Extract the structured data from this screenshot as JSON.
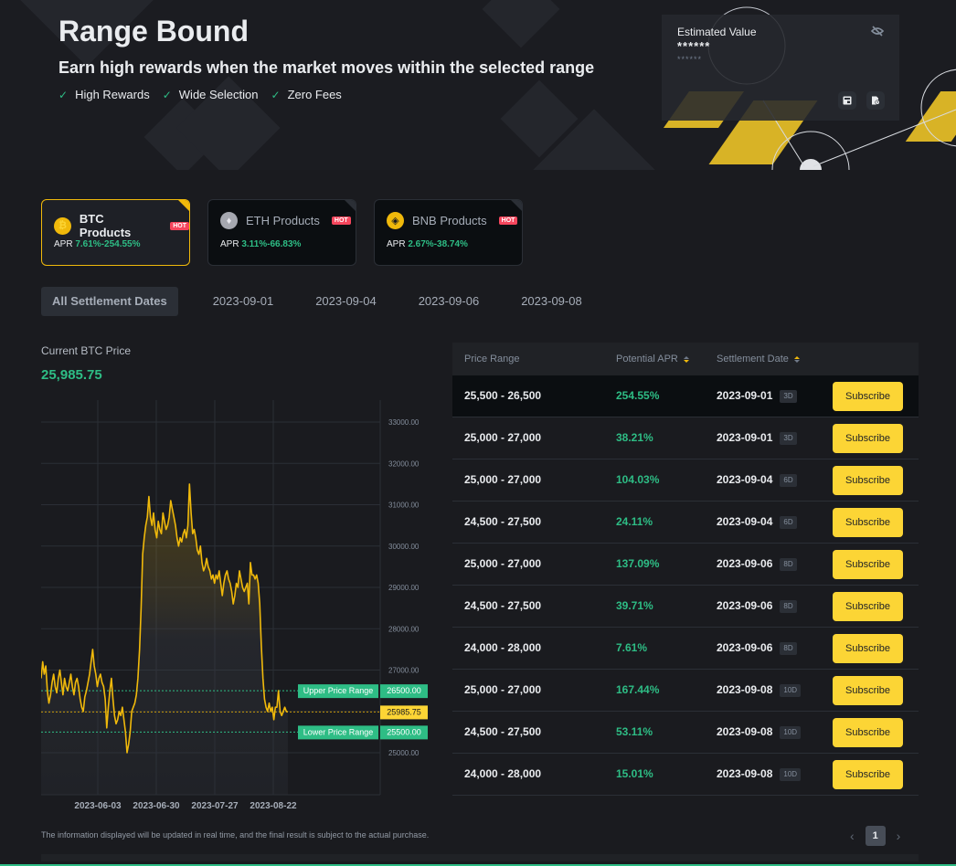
{
  "hero": {
    "title": "Range Bound",
    "subtitle": "Earn high rewards when the market moves within the selected range",
    "features": [
      "High Rewards",
      "Wide Selection",
      "Zero Fees"
    ]
  },
  "estimated": {
    "label": "Estimated Value",
    "value": "******",
    "sub_value": "******"
  },
  "products": [
    {
      "name": "BTC Products",
      "coin": "btc",
      "glyph": "₿",
      "badge": "HOT",
      "apr_label": "APR",
      "apr": "7.61%-254.55%",
      "active": true
    },
    {
      "name": "ETH Products",
      "coin": "eth",
      "glyph": "♦",
      "badge": "HOT",
      "apr_label": "APR",
      "apr": "3.11%-66.83%",
      "active": false
    },
    {
      "name": "BNB Products",
      "coin": "bnb",
      "glyph": "◈",
      "badge": "HOT",
      "apr_label": "APR",
      "apr": "2.67%-38.74%",
      "active": false
    }
  ],
  "date_tabs": [
    "All Settlement Dates",
    "2023-09-01",
    "2023-09-04",
    "2023-09-06",
    "2023-09-08"
  ],
  "active_date_tab": 0,
  "current_price": {
    "label": "Current BTC Price",
    "value": "25,985.75"
  },
  "chart_data": {
    "type": "line",
    "title": "BTC Price",
    "xlabel": "",
    "ylabel": "",
    "x_ticks": [
      "2023-06-03",
      "2023-06-30",
      "2023-07-27",
      "2023-08-22"
    ],
    "y_ticks": [
      "33000.00",
      "32000.00",
      "31000.00",
      "30000.00",
      "29000.00",
      "28000.00",
      "27000.00",
      "25000.00"
    ],
    "ylim": [
      24200,
      33500
    ],
    "grid": true,
    "series": [
      {
        "name": "BTC",
        "values": [
          26800,
          27200,
          26900,
          27100,
          26500,
          26200,
          26400,
          26700,
          26900,
          26600,
          26450,
          26800,
          27000,
          26700,
          26400,
          26800,
          26600,
          26500,
          26700,
          26900,
          26600,
          26400,
          26700,
          26800,
          26600,
          26300,
          26100,
          26000,
          26350,
          26500,
          26700,
          26900,
          27200,
          27500,
          27100,
          26900,
          26600,
          26800,
          26900,
          26700,
          26600,
          26300,
          25600,
          26100,
          26500,
          26800,
          26300,
          25900,
          25700,
          25800,
          26000,
          25900,
          26100,
          25800,
          25500,
          25000,
          25200,
          25500,
          26000,
          26100,
          26200,
          26400,
          26800,
          27500,
          28500,
          29800,
          30200,
          30500,
          30700,
          31200,
          30700,
          30500,
          30800,
          30400,
          30200,
          30600,
          30400,
          30300,
          30800,
          30600,
          30400,
          30500,
          30700,
          31100,
          30900,
          30700,
          30500,
          30200,
          30000,
          30200,
          30100,
          30300,
          30400,
          30200,
          30500,
          31500,
          30800,
          30300,
          30400,
          30200,
          29900,
          29800,
          30000,
          29600,
          29400,
          29500,
          29700,
          29500,
          29400,
          29200,
          29300,
          29100,
          29300,
          29200,
          29400,
          29100,
          28800,
          29100,
          29300,
          29400,
          29200,
          29100,
          28900,
          28600,
          28800,
          29100,
          29000,
          29400,
          29200,
          29000,
          28900,
          29000,
          29100,
          28600,
          29600,
          29300,
          29300,
          29200,
          29300,
          29100,
          28600,
          27600,
          26800,
          26300,
          26100,
          26000,
          26200,
          26000,
          26100,
          25800,
          26100,
          26100,
          26500,
          26000,
          25900,
          26000,
          26100,
          26000,
          25985.75
        ]
      }
    ],
    "current_price": 25985.75,
    "upper_range": {
      "label": "Upper Price Range",
      "value": 26500.0,
      "display": "26500.00"
    },
    "lower_range": {
      "label": "Lower Price Range",
      "value": 25500.0,
      "display": "25500.00"
    },
    "current_display": "25985.75"
  },
  "disclaimer": "The information displayed will be updated in real time, and the final result is subject to the actual purchase.",
  "table": {
    "headers": {
      "range": "Price Range",
      "apr": "Potential APR",
      "date": "Settlement Date"
    },
    "subscribe_label": "Subscribe",
    "rows": [
      {
        "range": "25,500 - 26,500",
        "apr": "254.55%",
        "date": "2023-09-01",
        "days": "3D"
      },
      {
        "range": "25,000 - 27,000",
        "apr": "38.21%",
        "date": "2023-09-01",
        "days": "3D"
      },
      {
        "range": "25,000 - 27,000",
        "apr": "104.03%",
        "date": "2023-09-04",
        "days": "6D"
      },
      {
        "range": "24,500 - 27,500",
        "apr": "24.11%",
        "date": "2023-09-04",
        "days": "6D"
      },
      {
        "range": "25,000 - 27,000",
        "apr": "137.09%",
        "date": "2023-09-06",
        "days": "8D"
      },
      {
        "range": "24,500 - 27,500",
        "apr": "39.71%",
        "date": "2023-09-06",
        "days": "8D"
      },
      {
        "range": "24,000 - 28,000",
        "apr": "7.61%",
        "date": "2023-09-06",
        "days": "8D"
      },
      {
        "range": "25,000 - 27,000",
        "apr": "167.44%",
        "date": "2023-09-08",
        "days": "10D"
      },
      {
        "range": "24,500 - 27,500",
        "apr": "53.11%",
        "date": "2023-09-08",
        "days": "10D"
      },
      {
        "range": "24,000 - 28,000",
        "apr": "15.01%",
        "date": "2023-09-08",
        "days": "10D"
      }
    ]
  },
  "pagination": {
    "current": "1",
    "prev": "‹",
    "next": "›"
  },
  "colors": {
    "accent": "#fcd535",
    "positive": "#2ebd85",
    "hot": "#f6465d",
    "line": "#f0b90b"
  }
}
